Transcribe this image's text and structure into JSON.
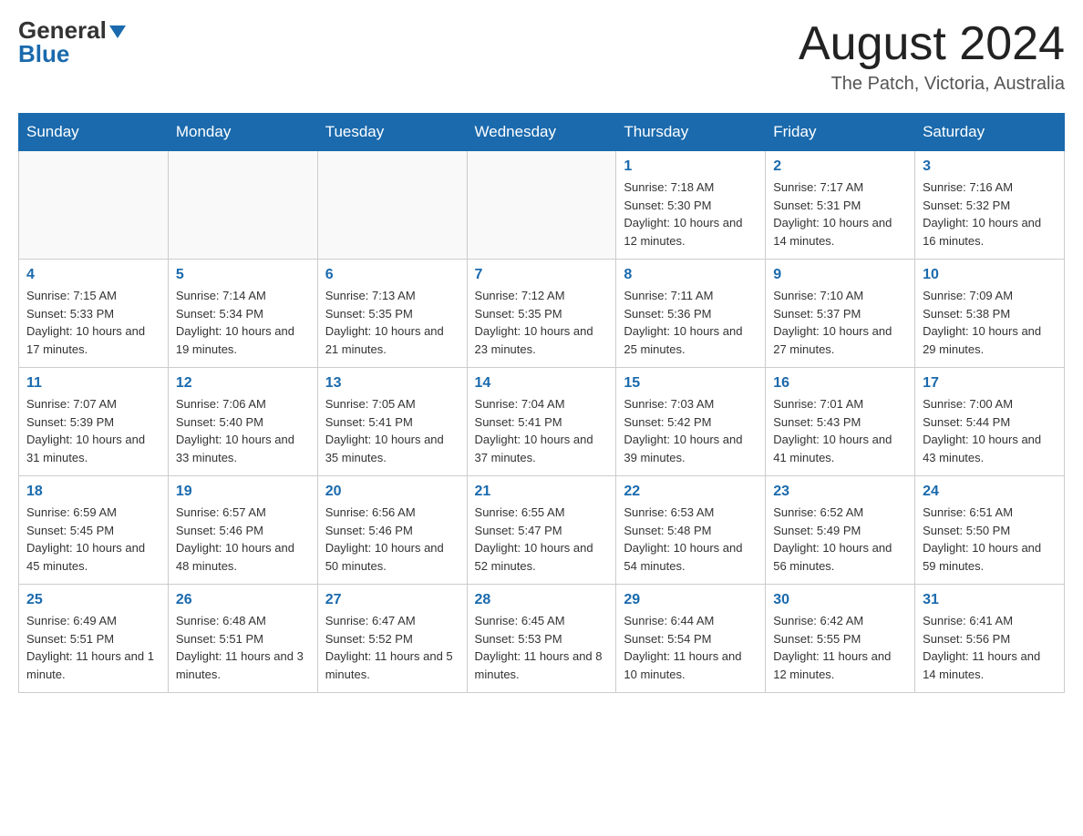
{
  "header": {
    "logo_line1": "General",
    "logo_line2": "Blue",
    "month_title": "August 2024",
    "location": "The Patch, Victoria, Australia"
  },
  "calendar": {
    "days_of_week": [
      "Sunday",
      "Monday",
      "Tuesday",
      "Wednesday",
      "Thursday",
      "Friday",
      "Saturday"
    ],
    "weeks": [
      [
        {
          "num": "",
          "info": ""
        },
        {
          "num": "",
          "info": ""
        },
        {
          "num": "",
          "info": ""
        },
        {
          "num": "",
          "info": ""
        },
        {
          "num": "1",
          "info": "Sunrise: 7:18 AM\nSunset: 5:30 PM\nDaylight: 10 hours and 12 minutes."
        },
        {
          "num": "2",
          "info": "Sunrise: 7:17 AM\nSunset: 5:31 PM\nDaylight: 10 hours and 14 minutes."
        },
        {
          "num": "3",
          "info": "Sunrise: 7:16 AM\nSunset: 5:32 PM\nDaylight: 10 hours and 16 minutes."
        }
      ],
      [
        {
          "num": "4",
          "info": "Sunrise: 7:15 AM\nSunset: 5:33 PM\nDaylight: 10 hours and 17 minutes."
        },
        {
          "num": "5",
          "info": "Sunrise: 7:14 AM\nSunset: 5:34 PM\nDaylight: 10 hours and 19 minutes."
        },
        {
          "num": "6",
          "info": "Sunrise: 7:13 AM\nSunset: 5:35 PM\nDaylight: 10 hours and 21 minutes."
        },
        {
          "num": "7",
          "info": "Sunrise: 7:12 AM\nSunset: 5:35 PM\nDaylight: 10 hours and 23 minutes."
        },
        {
          "num": "8",
          "info": "Sunrise: 7:11 AM\nSunset: 5:36 PM\nDaylight: 10 hours and 25 minutes."
        },
        {
          "num": "9",
          "info": "Sunrise: 7:10 AM\nSunset: 5:37 PM\nDaylight: 10 hours and 27 minutes."
        },
        {
          "num": "10",
          "info": "Sunrise: 7:09 AM\nSunset: 5:38 PM\nDaylight: 10 hours and 29 minutes."
        }
      ],
      [
        {
          "num": "11",
          "info": "Sunrise: 7:07 AM\nSunset: 5:39 PM\nDaylight: 10 hours and 31 minutes."
        },
        {
          "num": "12",
          "info": "Sunrise: 7:06 AM\nSunset: 5:40 PM\nDaylight: 10 hours and 33 minutes."
        },
        {
          "num": "13",
          "info": "Sunrise: 7:05 AM\nSunset: 5:41 PM\nDaylight: 10 hours and 35 minutes."
        },
        {
          "num": "14",
          "info": "Sunrise: 7:04 AM\nSunset: 5:41 PM\nDaylight: 10 hours and 37 minutes."
        },
        {
          "num": "15",
          "info": "Sunrise: 7:03 AM\nSunset: 5:42 PM\nDaylight: 10 hours and 39 minutes."
        },
        {
          "num": "16",
          "info": "Sunrise: 7:01 AM\nSunset: 5:43 PM\nDaylight: 10 hours and 41 minutes."
        },
        {
          "num": "17",
          "info": "Sunrise: 7:00 AM\nSunset: 5:44 PM\nDaylight: 10 hours and 43 minutes."
        }
      ],
      [
        {
          "num": "18",
          "info": "Sunrise: 6:59 AM\nSunset: 5:45 PM\nDaylight: 10 hours and 45 minutes."
        },
        {
          "num": "19",
          "info": "Sunrise: 6:57 AM\nSunset: 5:46 PM\nDaylight: 10 hours and 48 minutes."
        },
        {
          "num": "20",
          "info": "Sunrise: 6:56 AM\nSunset: 5:46 PM\nDaylight: 10 hours and 50 minutes."
        },
        {
          "num": "21",
          "info": "Sunrise: 6:55 AM\nSunset: 5:47 PM\nDaylight: 10 hours and 52 minutes."
        },
        {
          "num": "22",
          "info": "Sunrise: 6:53 AM\nSunset: 5:48 PM\nDaylight: 10 hours and 54 minutes."
        },
        {
          "num": "23",
          "info": "Sunrise: 6:52 AM\nSunset: 5:49 PM\nDaylight: 10 hours and 56 minutes."
        },
        {
          "num": "24",
          "info": "Sunrise: 6:51 AM\nSunset: 5:50 PM\nDaylight: 10 hours and 59 minutes."
        }
      ],
      [
        {
          "num": "25",
          "info": "Sunrise: 6:49 AM\nSunset: 5:51 PM\nDaylight: 11 hours and 1 minute."
        },
        {
          "num": "26",
          "info": "Sunrise: 6:48 AM\nSunset: 5:51 PM\nDaylight: 11 hours and 3 minutes."
        },
        {
          "num": "27",
          "info": "Sunrise: 6:47 AM\nSunset: 5:52 PM\nDaylight: 11 hours and 5 minutes."
        },
        {
          "num": "28",
          "info": "Sunrise: 6:45 AM\nSunset: 5:53 PM\nDaylight: 11 hours and 8 minutes."
        },
        {
          "num": "29",
          "info": "Sunrise: 6:44 AM\nSunset: 5:54 PM\nDaylight: 11 hours and 10 minutes."
        },
        {
          "num": "30",
          "info": "Sunrise: 6:42 AM\nSunset: 5:55 PM\nDaylight: 11 hours and 12 minutes."
        },
        {
          "num": "31",
          "info": "Sunrise: 6:41 AM\nSunset: 5:56 PM\nDaylight: 11 hours and 14 minutes."
        }
      ]
    ]
  }
}
